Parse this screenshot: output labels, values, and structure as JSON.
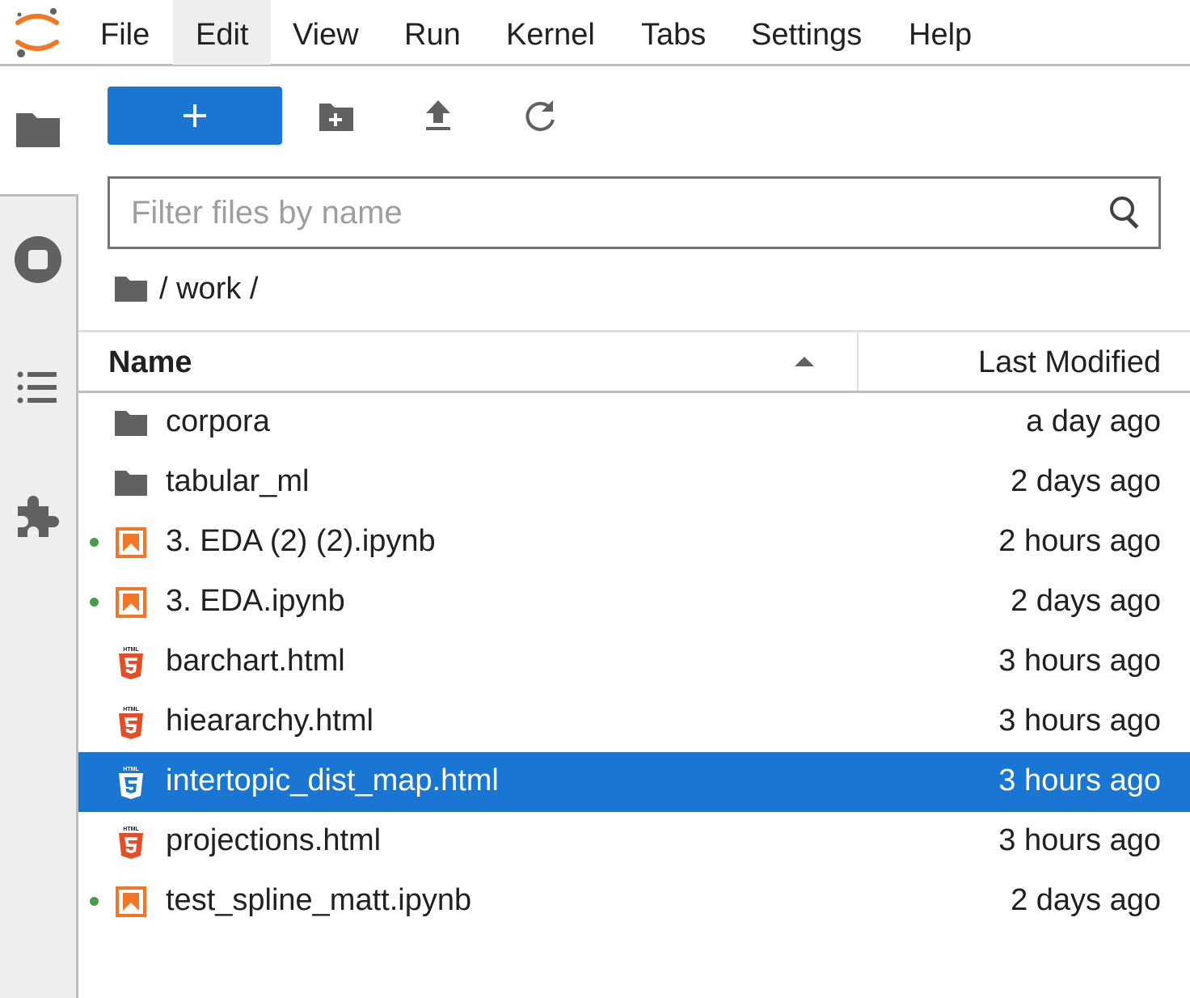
{
  "menu": [
    "File",
    "Edit",
    "View",
    "Run",
    "Kernel",
    "Tabs",
    "Settings",
    "Help"
  ],
  "menu_active": "Edit",
  "sidebar": [
    "folder-icon",
    "stop-circle-icon",
    "list-icon",
    "extension-puzzle-icon"
  ],
  "toolbar": {
    "new_label": "+",
    "icons": [
      "new-folder-icon",
      "upload-icon",
      "refresh-icon"
    ]
  },
  "filter": {
    "placeholder": "Filter files by name",
    "value": ""
  },
  "breadcrumb": {
    "path": "/ work /"
  },
  "table": {
    "name_header": "Name",
    "modified_header": "Last Modified",
    "sort": "ascending"
  },
  "files": [
    {
      "name": "corpora",
      "modified": "a day ago",
      "type": "folder",
      "running": false,
      "selected": false
    },
    {
      "name": "tabular_ml",
      "modified": "2 days ago",
      "type": "folder",
      "running": false,
      "selected": false
    },
    {
      "name": "3. EDA (2) (2).ipynb",
      "modified": "2 hours ago",
      "type": "notebook",
      "running": true,
      "selected": false
    },
    {
      "name": "3. EDA.ipynb",
      "modified": "2 days ago",
      "type": "notebook",
      "running": true,
      "selected": false
    },
    {
      "name": "barchart.html",
      "modified": "3 hours ago",
      "type": "html",
      "running": false,
      "selected": false
    },
    {
      "name": "hieararchy.html",
      "modified": "3 hours ago",
      "type": "html",
      "running": false,
      "selected": false
    },
    {
      "name": "intertopic_dist_map.html",
      "modified": "3 hours ago",
      "type": "html",
      "running": false,
      "selected": true
    },
    {
      "name": "projections.html",
      "modified": "3 hours ago",
      "type": "html",
      "running": false,
      "selected": false
    },
    {
      "name": "test_spline_matt.ipynb",
      "modified": "2 days ago",
      "type": "notebook",
      "running": true,
      "selected": false
    }
  ],
  "colors": {
    "accent": "#1976d2",
    "notebook": "#f37626",
    "html": "#e44d26",
    "running": "#43a047",
    "icon": "#616161"
  }
}
